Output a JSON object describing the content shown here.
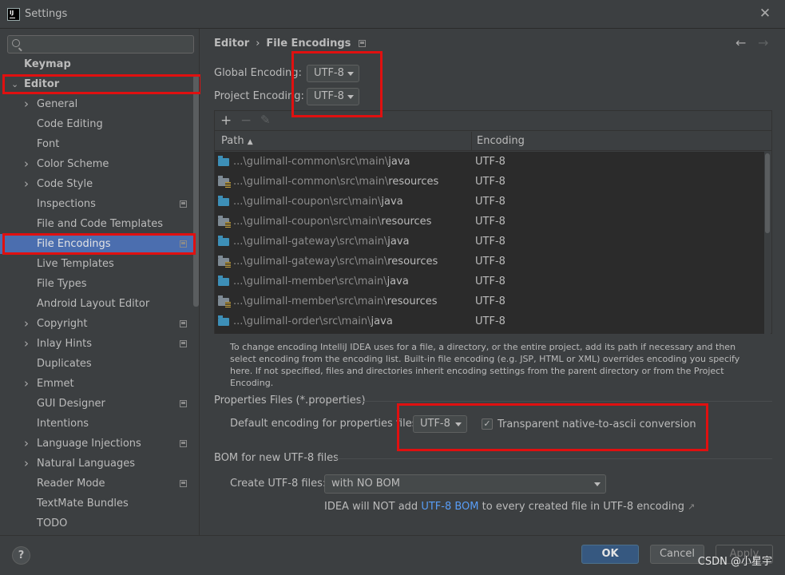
{
  "window": {
    "title": "Settings",
    "app_icon": "IJ",
    "close_glyph": "✕"
  },
  "sidebar": {
    "search": {
      "value": "",
      "placeholder": ""
    },
    "items": [
      {
        "label": "Keymap",
        "level": 0
      },
      {
        "label": "Editor",
        "level": 0,
        "expanded": true
      },
      {
        "label": "General",
        "level": 1,
        "chevron": true
      },
      {
        "label": "Code Editing",
        "level": 1
      },
      {
        "label": "Font",
        "level": 1
      },
      {
        "label": "Color Scheme",
        "level": 1,
        "chevron": true
      },
      {
        "label": "Code Style",
        "level": 1,
        "chevron": true
      },
      {
        "label": "Inspections",
        "level": 1,
        "project_icon": true
      },
      {
        "label": "File and Code Templates",
        "level": 1
      },
      {
        "label": "File Encodings",
        "level": 1,
        "project_icon": true,
        "selected": true
      },
      {
        "label": "Live Templates",
        "level": 1
      },
      {
        "label": "File Types",
        "level": 1
      },
      {
        "label": "Android Layout Editor",
        "level": 1
      },
      {
        "label": "Copyright",
        "level": 1,
        "chevron": true,
        "project_icon": true
      },
      {
        "label": "Inlay Hints",
        "level": 1,
        "chevron": true,
        "project_icon": true
      },
      {
        "label": "Duplicates",
        "level": 1
      },
      {
        "label": "Emmet",
        "level": 1,
        "chevron": true
      },
      {
        "label": "GUI Designer",
        "level": 1,
        "project_icon": true
      },
      {
        "label": "Intentions",
        "level": 1
      },
      {
        "label": "Language Injections",
        "level": 1,
        "chevron": true,
        "project_icon": true
      },
      {
        "label": "Natural Languages",
        "level": 1,
        "chevron": true
      },
      {
        "label": "Reader Mode",
        "level": 1,
        "project_icon": true
      },
      {
        "label": "TextMate Bundles",
        "level": 1
      },
      {
        "label": "TODO",
        "level": 1
      }
    ]
  },
  "breadcrumb": {
    "parent": "Editor",
    "separator": "›",
    "current": "File Encodings",
    "back_glyph": "←",
    "forward_glyph": "→"
  },
  "encodings": {
    "global_label": "Global Encoding:",
    "global_value": "UTF-8",
    "project_label": "Project Encoding:",
    "project_value": "UTF-8"
  },
  "table": {
    "toolbar": {
      "add": "+",
      "remove": "−",
      "edit": "✎"
    },
    "columns": {
      "path": "Path",
      "sort_glyph": "▲",
      "encoding": "Encoding"
    },
    "rows": [
      {
        "prefix": "...\\gulimall-common\\src\\main\\",
        "leaf": "java",
        "kind": "source",
        "encoding": "UTF-8"
      },
      {
        "prefix": "...\\gulimall-common\\src\\main\\",
        "leaf": "resources",
        "kind": "resource",
        "encoding": "UTF-8"
      },
      {
        "prefix": "...\\gulimall-coupon\\src\\main\\",
        "leaf": "java",
        "kind": "source",
        "encoding": "UTF-8"
      },
      {
        "prefix": "...\\gulimall-coupon\\src\\main\\",
        "leaf": "resources",
        "kind": "resource",
        "encoding": "UTF-8"
      },
      {
        "prefix": "...\\gulimall-gateway\\src\\main\\",
        "leaf": "java",
        "kind": "source",
        "encoding": "UTF-8"
      },
      {
        "prefix": "...\\gulimall-gateway\\src\\main\\",
        "leaf": "resources",
        "kind": "resource",
        "encoding": "UTF-8"
      },
      {
        "prefix": "...\\gulimall-member\\src\\main\\",
        "leaf": "java",
        "kind": "source",
        "encoding": "UTF-8"
      },
      {
        "prefix": "...\\gulimall-member\\src\\main\\",
        "leaf": "resources",
        "kind": "resource",
        "encoding": "UTF-8"
      },
      {
        "prefix": "...\\gulimall-order\\src\\main\\",
        "leaf": "java",
        "kind": "source",
        "encoding": "UTF-8"
      }
    ]
  },
  "help_text": "To change encoding IntelliJ IDEA uses for a file, a directory, or the entire project, add its path if necessary and then select encoding from the encoding list. Built-in file encoding (e.g. JSP, HTML or XML) overrides encoding you specify here. If not specified, files and directories inherit encoding settings from the parent directory or from the Project Encoding.",
  "properties": {
    "section_title": "Properties Files (*.properties)",
    "default_label": "Default encoding for properties files:",
    "default_value": "UTF-8",
    "native_ascii_label": "Transparent native-to-ascii conversion",
    "native_ascii_checked": true,
    "check_glyph": "✓"
  },
  "bom": {
    "section_title": "BOM for new UTF-8 files",
    "create_label": "Create UTF-8 files:",
    "create_value": "with NO BOM",
    "note_before": "IDEA will NOT add ",
    "note_link": "UTF-8 BOM",
    "note_after": " to every created file in UTF-8 encoding",
    "note_ext_glyph": "↗"
  },
  "footer": {
    "help_glyph": "?",
    "ok": "OK",
    "cancel": "Cancel",
    "apply": "Apply"
  },
  "watermark": "CSDN @小星宇",
  "colors": {
    "accent": "#4b6eaf",
    "highlight_box": "#e01010",
    "link": "#589df6",
    "ok_button": "#365880"
  }
}
